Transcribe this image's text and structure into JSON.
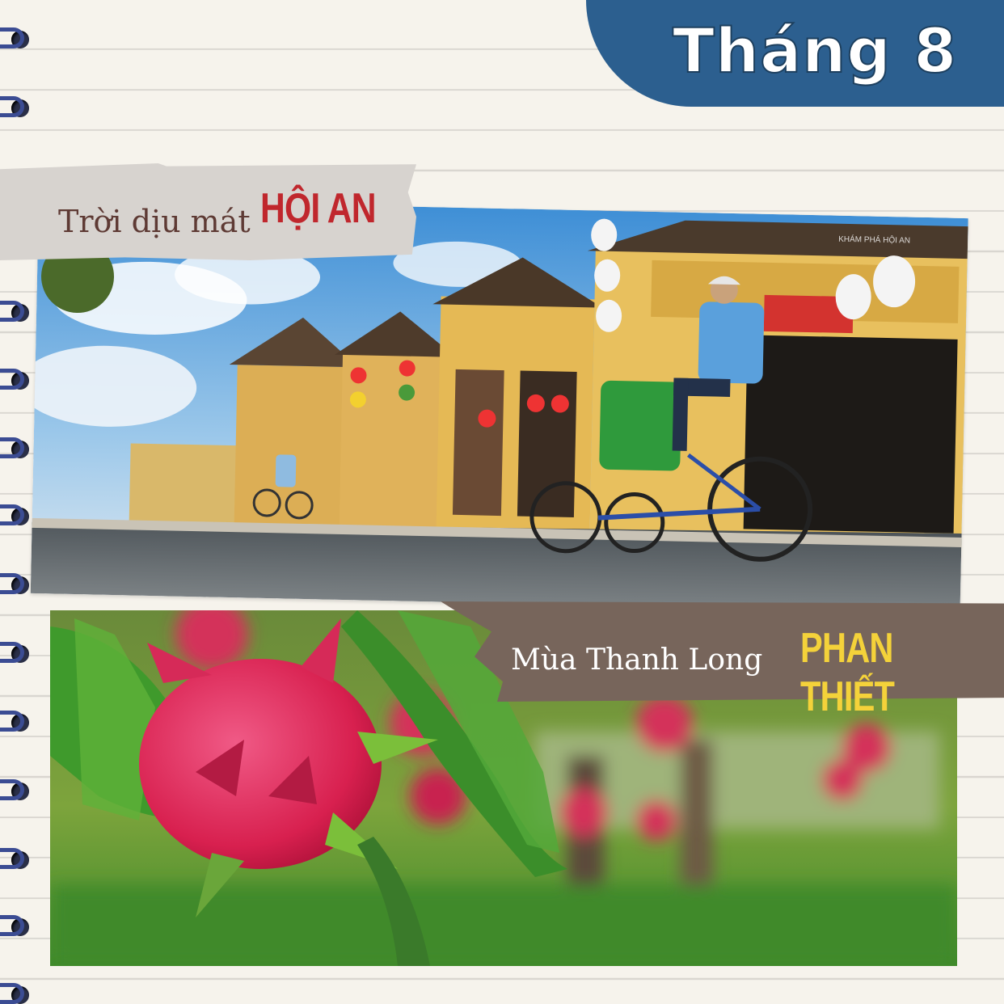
{
  "header": {
    "month_label": "Tháng 8"
  },
  "destinations": [
    {
      "caption": "Trời dịu mát",
      "place": "HỘI AN",
      "photo_watermark": "KHÁM PHÁ HỘI AN"
    },
    {
      "caption": "Mùa Thanh Long",
      "place": "PHAN THIẾT"
    }
  ],
  "colors": {
    "paper": "#f6f3ec",
    "ruled_line": "#d9d6d0",
    "month_tab": "#2c5f8f",
    "hoi_an_accent": "#c0272d",
    "phan_thiet_accent": "#f4d23a",
    "tape_light": "#d7d3cf",
    "tape_dark": "#77655b",
    "binding_ring": "#3b4c93"
  },
  "icons": {
    "binding": "spiral-ring-icon"
  }
}
